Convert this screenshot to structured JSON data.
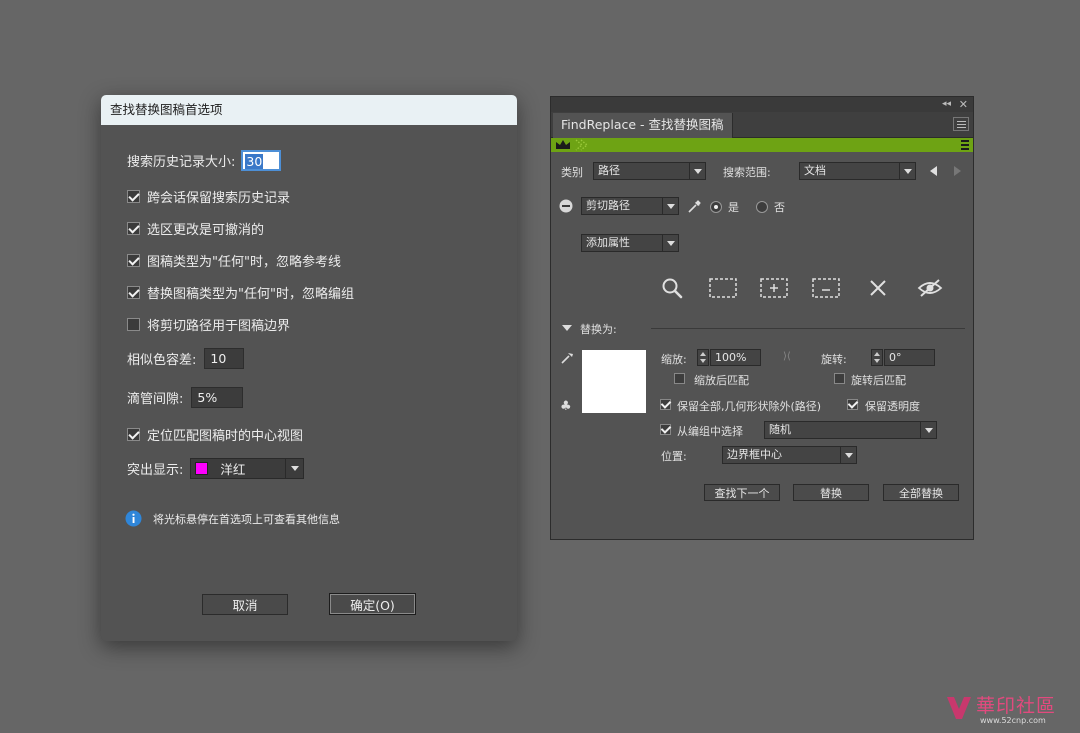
{
  "prefs_dialog": {
    "title": "查找替换图稿首选项",
    "history_size_label": "搜索历史记录大小:",
    "history_size_value": "30",
    "options": [
      {
        "label": "跨会话保留搜索历史记录",
        "checked": true
      },
      {
        "label": "选区更改是可撤消的",
        "checked": true
      },
      {
        "label": "图稿类型为\"任何\"时，忽略参考线",
        "checked": true
      },
      {
        "label": "替换图稿类型为\"任何\"时，忽略编组",
        "checked": true
      },
      {
        "label": "将剪切路径用于图稿边界",
        "checked": false
      }
    ],
    "color_tolerance_label": "相似色容差:",
    "color_tolerance_value": "10",
    "eyedropper_gap_label": "滴管间隙:",
    "eyedropper_gap_value": "5%",
    "center_view_label": "定位匹配图稿时的中心视图",
    "center_view_checked": true,
    "highlight_label": "突出显示:",
    "highlight_value": "洋红",
    "highlight_color": "#ff00ff",
    "info_text": "将光标悬停在首选项上可查看其他信息",
    "cancel_label": "取消",
    "ok_label": "确定(O)"
  },
  "findreplace_panel": {
    "tab_title": "FindReplace - 查找替换图稿",
    "accent_color": "#6ea314",
    "category_label": "类别",
    "category_value": "路径",
    "scope_label": "搜索范围:",
    "scope_value": "文档",
    "clip_path_value": "剪切路径",
    "yes_label": "是",
    "no_label": "否",
    "yes_selected": true,
    "add_attribute_value": "添加属性",
    "tool_icons": [
      "search-icon",
      "select-marquee-icon",
      "add-to-selection-icon",
      "subtract-from-selection-icon",
      "clear-icon",
      "hide-icon"
    ],
    "replace_with_label": "替换为:",
    "scale_label": "缩放:",
    "scale_value": "100%",
    "rotate_label": "旋转:",
    "rotate_value": "0°",
    "scale_after_match_label": "缩放后匹配",
    "rotate_after_match_label": "旋转后匹配",
    "keep_all_label": "保留全部,几何形状除外(路径)",
    "keep_all_checked": true,
    "keep_opacity_label": "保留透明度",
    "keep_opacity_checked": true,
    "from_group_label": "从编组中选择",
    "from_group_checked": true,
    "from_group_value": "随机",
    "position_label": "位置:",
    "position_value": "边界框中心",
    "find_next_label": "查找下一个",
    "replace_label": "替换",
    "replace_all_label": "全部替换"
  },
  "watermark": {
    "text": "華印社區",
    "url": "www.52cnp.com"
  }
}
